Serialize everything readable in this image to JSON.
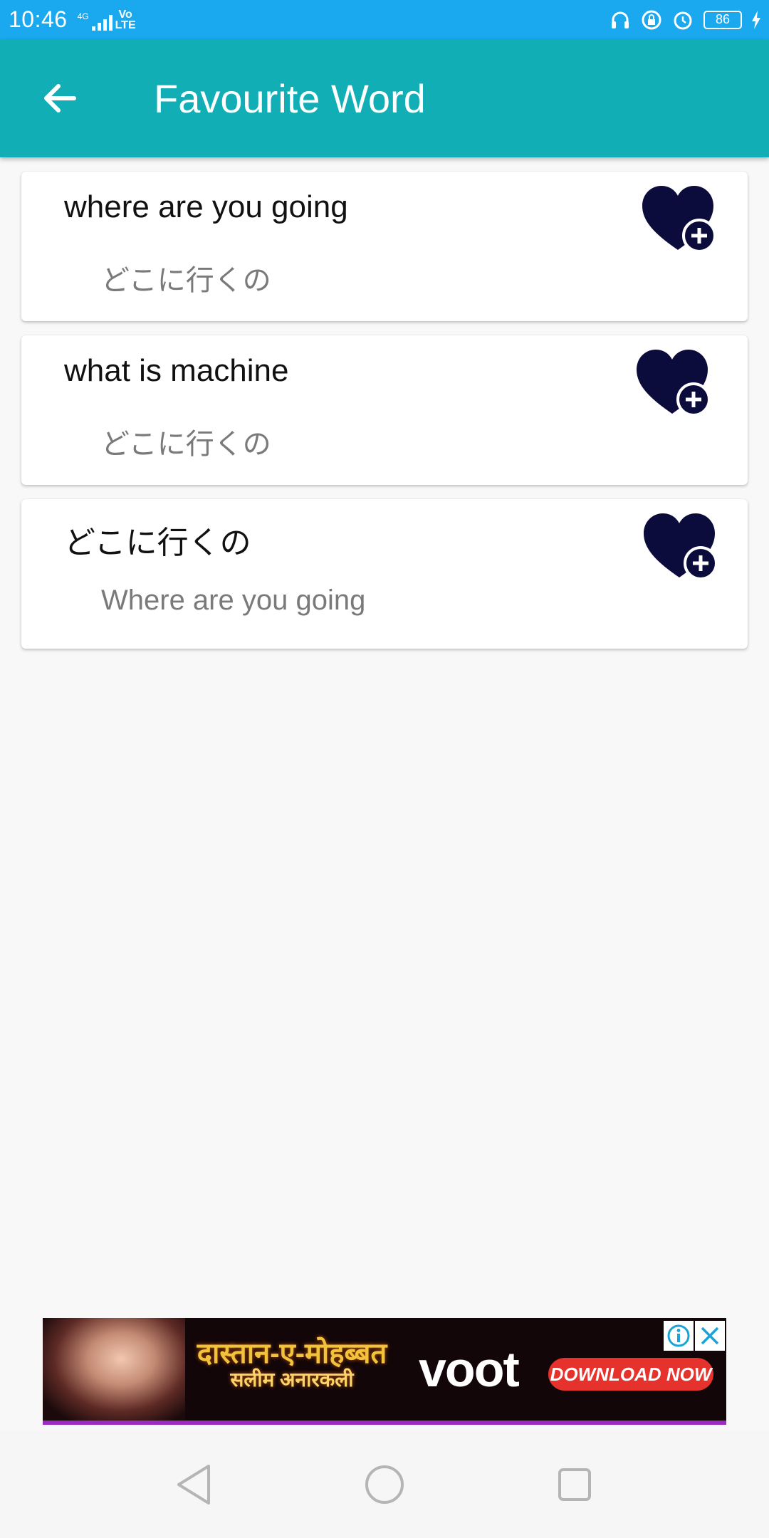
{
  "status_bar": {
    "time": "10:46",
    "network_small": "4G",
    "volte_top": "Vo",
    "volte_bottom": "LTE",
    "battery": "86",
    "icons": [
      "headphones-icon",
      "lock-rotation-icon",
      "alarm-icon",
      "battery-icon",
      "charging-icon"
    ]
  },
  "app_bar": {
    "title": "Favourite Word",
    "back_icon": "arrow-left-icon",
    "color": "#12aeb6"
  },
  "words": [
    {
      "title": "where are you going",
      "translation": "どこに行くの"
    },
    {
      "title": "what is machine",
      "translation": "どこに行くの"
    },
    {
      "title": "どこに行くの",
      "translation": "Where are you going"
    }
  ],
  "favorite_icon": "heart-plus-icon",
  "favorite_color": "#0b0c3b",
  "ad": {
    "hindi_title": "दास्तान-ए-मोहब्बत",
    "hindi_sub": "सलीम अनारकली",
    "brand": "voot",
    "cta": "DOWNLOAD NOW"
  },
  "nav_bar": {
    "back_icon": "triangle-back-icon",
    "home_icon": "circle-home-icon",
    "recents_icon": "square-recents-icon"
  }
}
